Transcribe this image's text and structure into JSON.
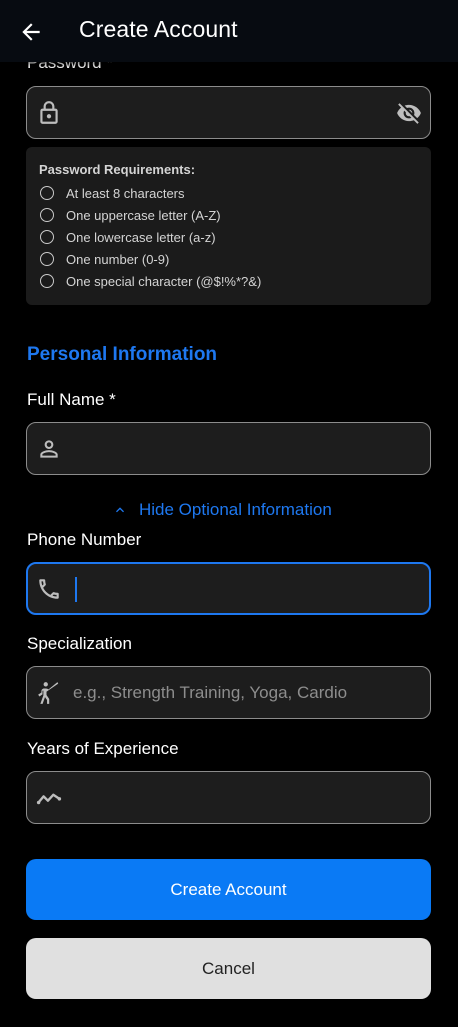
{
  "appbar": {
    "title": "Create Account"
  },
  "password": {
    "label": "Password *",
    "value": "",
    "requirements_title": "Password Requirements:",
    "requirements": [
      "At least 8 characters",
      "One uppercase letter (A-Z)",
      "One lowercase letter (a-z)",
      "One number (0-9)",
      "One special character (@$!%*?&)"
    ]
  },
  "section_personal": "Personal Information",
  "full_name": {
    "label": "Full Name *",
    "value": ""
  },
  "optional_toggle": "Hide Optional Information",
  "phone": {
    "label": "Phone Number",
    "value": ""
  },
  "specialization": {
    "label": "Specialization",
    "value": "",
    "placeholder": "e.g., Strength Training, Yoga, Cardio"
  },
  "experience": {
    "label": "Years of Experience",
    "value": ""
  },
  "buttons": {
    "create": "Create Account",
    "cancel": "Cancel"
  },
  "colors": {
    "accent": "#1e78f0",
    "button_primary": "#0a7af5",
    "background": "#000000"
  }
}
